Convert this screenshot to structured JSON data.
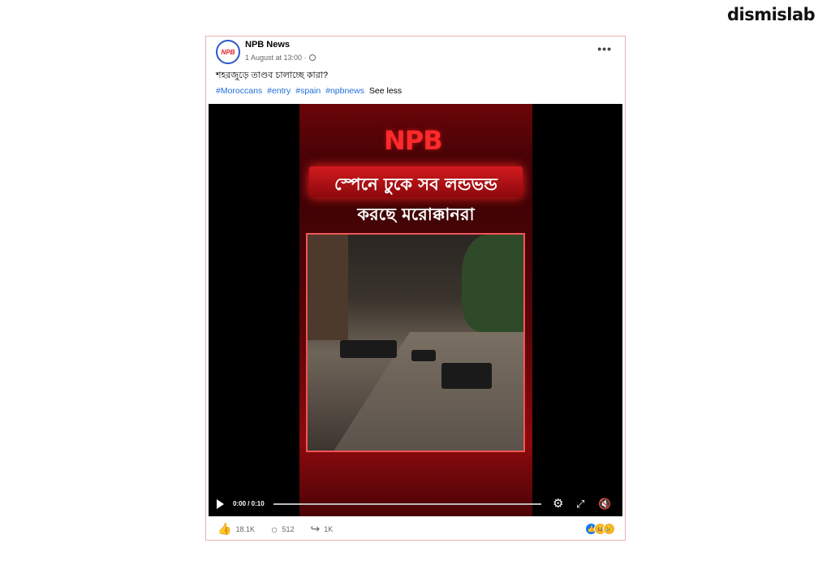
{
  "brand": "dismislab",
  "post": {
    "avatar_text": "NPB",
    "page_name": "NPB News",
    "timestamp": "1 August at 13:00 ·",
    "more_label": "•••",
    "caption": "শহরজুড়ে তাণ্ডব চালাচ্ছে কারা?",
    "hashtags": [
      "#Moroccans",
      "#entry",
      "#spain",
      "#npbnews"
    ],
    "see_less": "See less"
  },
  "video": {
    "logo_text": "NPB",
    "headline_line1": "স্পেনে ঢুকে সব লন্ডভন্ড",
    "headline_line2": "করছে মরোক্কানরা",
    "time": "0:00 / 0:10",
    "progress": 0.0,
    "icons": [
      "play-icon",
      "settings-icon",
      "fullscreen-icon",
      "mute-icon"
    ]
  },
  "actions": {
    "likes": "18.1K",
    "comments": "512",
    "shares": "1K",
    "reaction_icons": [
      "like",
      "haha",
      "sad"
    ]
  },
  "colors": {
    "accent_link": "#216fdb",
    "video_red": "#d11b1f"
  }
}
